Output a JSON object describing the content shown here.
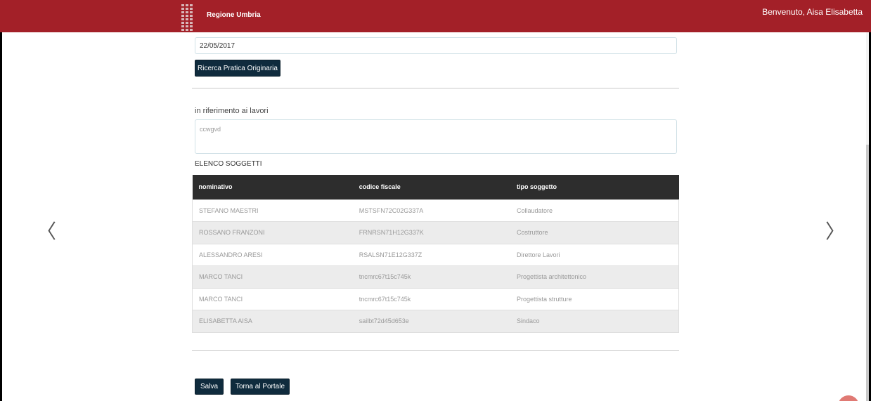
{
  "header": {
    "brand": "Regione Umbria",
    "welcome": "Benvenuto, Aisa Elisabetta",
    "logo_icon": "regione-umbria-logo-icon"
  },
  "form": {
    "date_value": "22/05/2017",
    "search_button": "Ricerca Pratica Originaria",
    "lavori_label": "in riferimento ai lavori",
    "lavori_value": "ccwgvd"
  },
  "soggetti": {
    "title": "ELENCO SOGGETTI",
    "columns": [
      "nominativo",
      "codice fiscale",
      "tipo soggetto"
    ],
    "rows": [
      [
        "STEFANO MAESTRI",
        "MSTSFN72C02G337A",
        "Collaudatore"
      ],
      [
        "ROSSANO FRANZONI",
        "FRNRSN71H12G337K",
        "Costruttore"
      ],
      [
        "ALESSANDRO ARESI",
        "RSALSN71E12G337Z",
        "Direttore Lavori"
      ],
      [
        "MARCO TANCI",
        "tncmrc67t15c745k",
        "Progettista architettonico"
      ],
      [
        "MARCO TANCI",
        "tncmrc67t15c745k",
        "Progettista strutture"
      ],
      [
        "ELISABETTA AISA",
        "sailbt72d45d653e",
        "Sindaco"
      ]
    ]
  },
  "actions": {
    "save": "Salva",
    "back": "Torna al Portale"
  },
  "nav": {
    "prev_icon": "chevron-left-icon",
    "next_icon": "chevron-right-icon"
  },
  "colors": {
    "header_bg": "#a32028",
    "button_bg": "#0f2b3d",
    "table_header_bg": "#2d2d2d"
  }
}
